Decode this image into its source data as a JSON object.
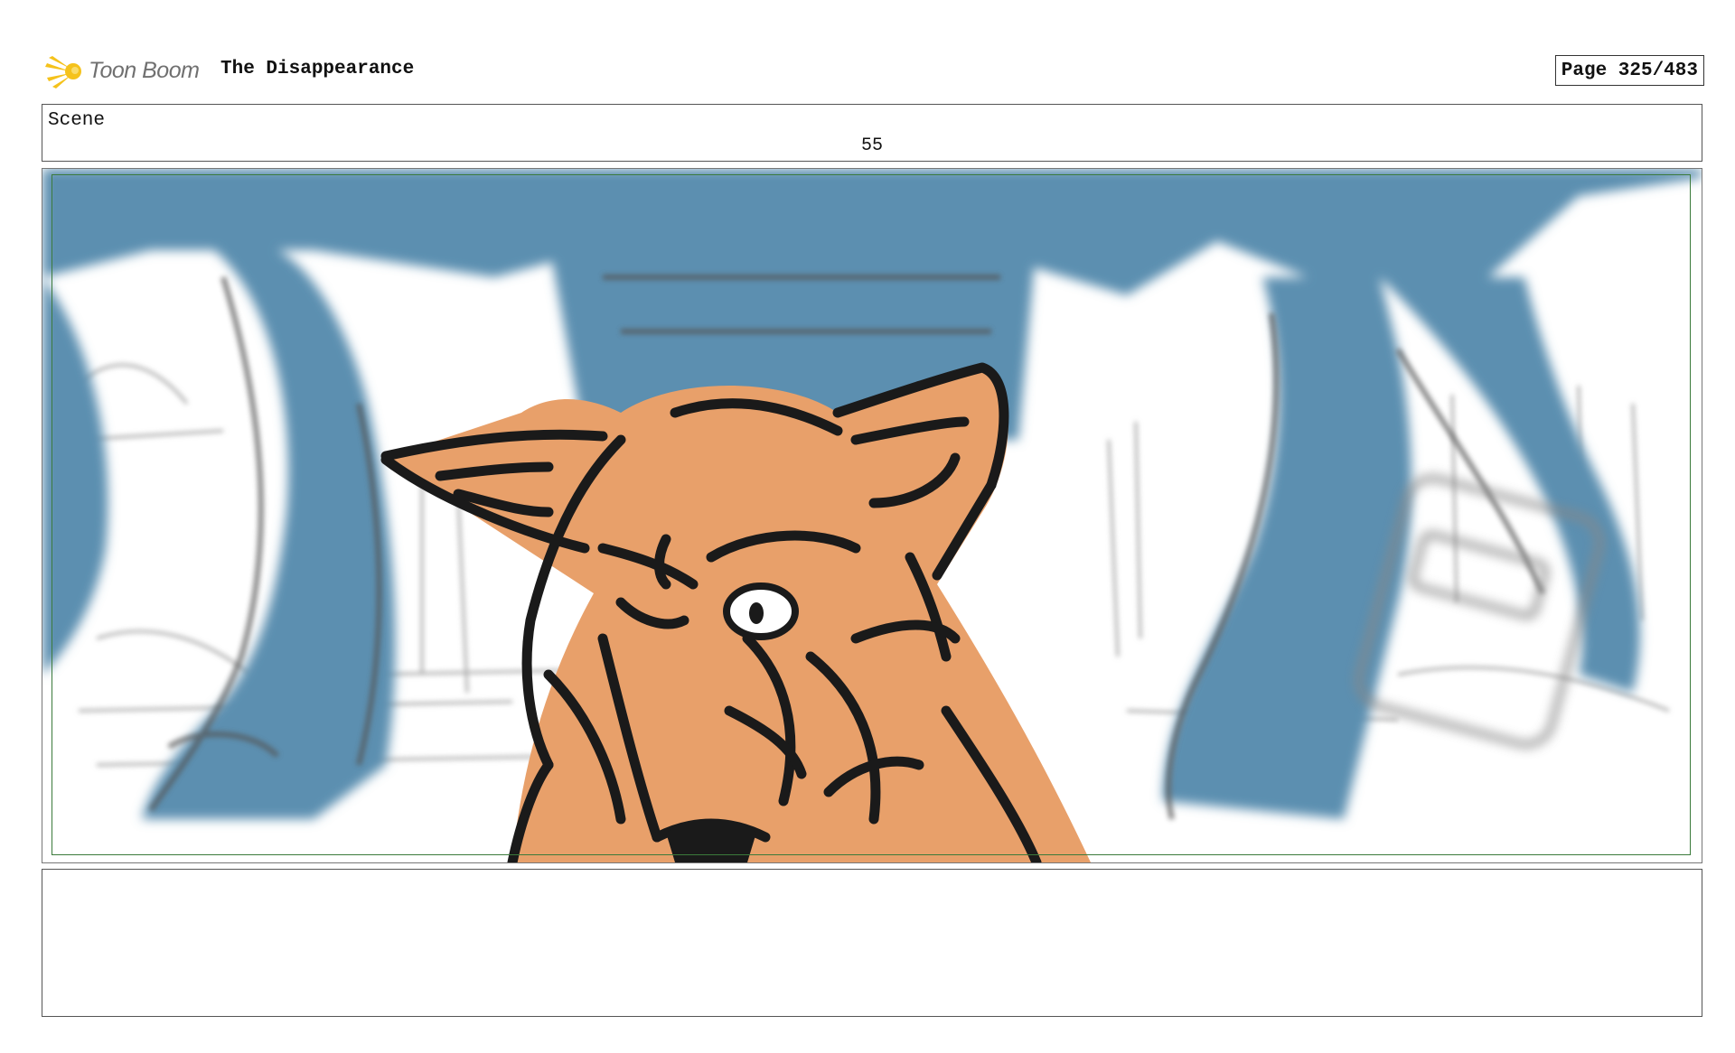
{
  "header": {
    "logo_text": "Toon Boom",
    "project_title": "The Disappearance",
    "page_label": "Page 325/483"
  },
  "scene": {
    "label": "Scene",
    "number": "55"
  },
  "panel": {
    "description_icon": "storyboard-panel-image"
  },
  "colors": {
    "sky_blue": "#5b8fb0",
    "fox_orange": "#e8a06a",
    "sketch_gray": "#9a9a9a",
    "ink": "#1a1a1a",
    "safe_frame": "#3b7a3b",
    "logo_yellow": "#f5c21b"
  },
  "notes": {
    "text": ""
  }
}
